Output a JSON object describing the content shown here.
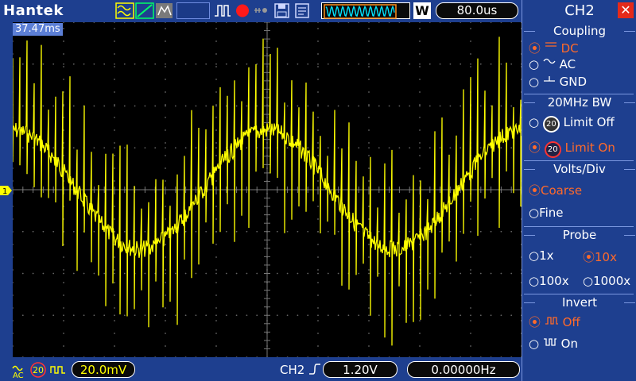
{
  "topbar": {
    "brand": "Hantek",
    "mode_letter": "W",
    "timebase": "80.0us"
  },
  "screen": {
    "trigger_time": "37.47ms",
    "ch1_marker": "1",
    "trace_color": "#ffff00"
  },
  "bottombar": {
    "coupling_icon": "ac-coupling-icon",
    "bw_icon": "20",
    "volts_div": "20.0mV",
    "trigger_source": "CH2",
    "trigger_level": "1.20V",
    "frequency": "0.00000Hz"
  },
  "menu": {
    "title": "CH2",
    "coupling": {
      "label": "Coupling",
      "options": [
        "DC",
        "AC",
        "GND"
      ],
      "selected": "DC"
    },
    "bw": {
      "label": "20MHz BW",
      "options": [
        "Limit Off",
        "Limit On"
      ],
      "icon_text": "20",
      "selected": "Limit On"
    },
    "volts_div": {
      "label": "Volts/Div",
      "options": [
        "Coarse",
        "Fine"
      ],
      "selected": "Coarse"
    },
    "probe": {
      "label": "Probe",
      "options": [
        "1x",
        "10x",
        "100x",
        "1000x"
      ],
      "selected": "10x"
    },
    "invert": {
      "label": "Invert",
      "options": [
        "Off",
        "On"
      ],
      "selected": "Off"
    }
  },
  "colors": {
    "background": "#1e3f8f",
    "selected": "#ff6a2a",
    "trace": "#ffff00",
    "close": "#e52a1a"
  }
}
